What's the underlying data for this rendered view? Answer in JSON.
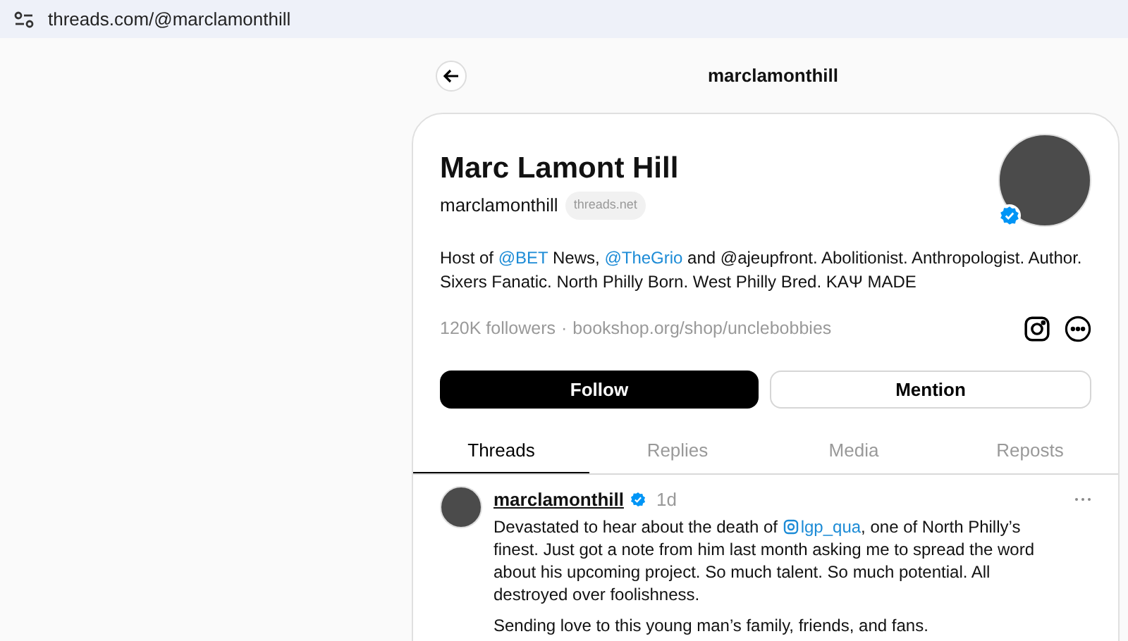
{
  "browser": {
    "url": "threads.com/@marclamonthill"
  },
  "header": {
    "title": "marclamonthill"
  },
  "profile": {
    "name": "Marc Lamont Hill",
    "username": "marclamonthill",
    "domain_badge": "threads.net",
    "verified": true,
    "bio": [
      {
        "kind": "text",
        "text": "Host of "
      },
      {
        "kind": "link",
        "text": "@BET"
      },
      {
        "kind": "text",
        "text": " News, "
      },
      {
        "kind": "link",
        "text": "@TheGrio"
      },
      {
        "kind": "text",
        "text": " and @ajeupfront. Abolitionist. Anthropologist. Author. Sixers Fanatic. North Philly Born. West Philly Bred. ΚΑΨ MADE"
      }
    ],
    "followers": "120K followers",
    "separator": "·",
    "link": "bookshop.org/shop/unclebobbies"
  },
  "buttons": [
    {
      "label": "Follow",
      "kind": "primary"
    },
    {
      "label": "Mention",
      "kind": "secondary"
    }
  ],
  "tabs": [
    {
      "label": "Threads",
      "selected": true
    },
    {
      "label": "Replies",
      "selected": false
    },
    {
      "label": "Media",
      "selected": false
    },
    {
      "label": "Reposts",
      "selected": false
    }
  ],
  "post": {
    "username": "marclamonthill",
    "verified": true,
    "time": "1d",
    "paragraphs": [
      [
        {
          "kind": "text",
          "text": "Devastated to hear about the death of "
        },
        {
          "kind": "mention",
          "text": "lgp_qua"
        },
        {
          "kind": "text",
          "text": ", one of North Philly’s finest. Just got a note from him last month asking me to spread the word about his upcoming project. So much talent. So much potential. All destroyed over foolishness."
        }
      ],
      [
        {
          "kind": "text",
          "text": "Sending love to this young man’s family, friends, and fans."
        }
      ]
    ]
  }
}
